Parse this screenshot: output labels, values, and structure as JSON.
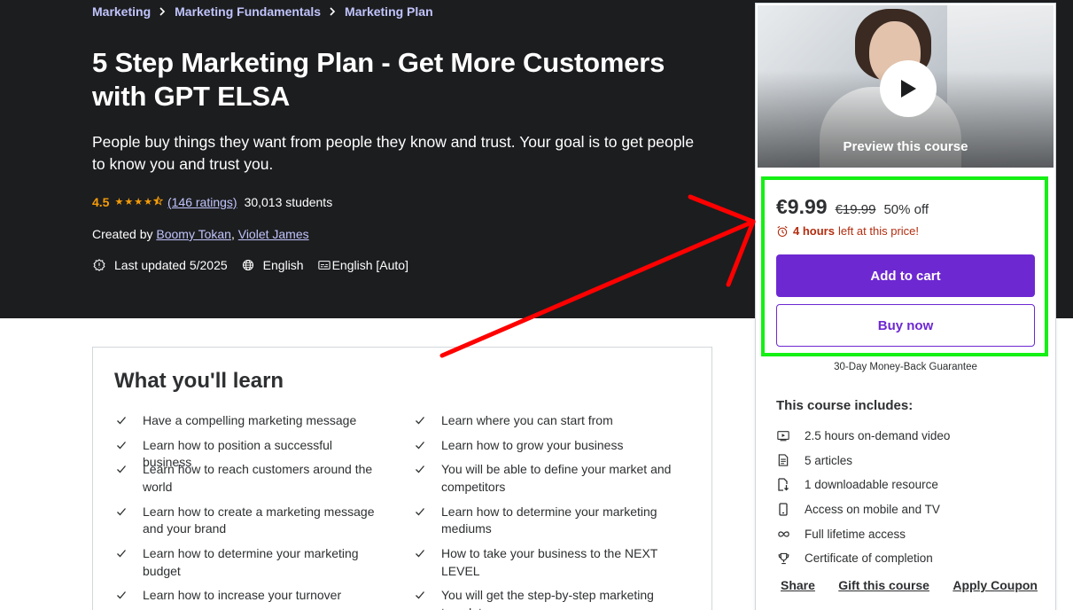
{
  "breadcrumb": [
    {
      "label": "Marketing"
    },
    {
      "label": "Marketing Fundamentals"
    },
    {
      "label": "Marketing Plan"
    }
  ],
  "course": {
    "title": "5 Step Marketing Plan - Get More Customers with GPT ELSA",
    "subtitle": "People buy things they want from people they know and trust. Your goal is to get people to know you and trust you.",
    "rating": "4.5",
    "rating_value": 4.5,
    "rating_max": 5,
    "ratings_count": "(146 ratings)",
    "students": "30,013 students",
    "created_by_label": "Created by",
    "instructors": [
      "Boomy Tokan",
      "Violet James"
    ],
    "instructor_separator": ",",
    "last_updated": "Last updated 5/2025",
    "language": "English",
    "captions": "English [Auto]"
  },
  "learn": {
    "title": "What you'll learn",
    "left": [
      "Have a compelling marketing message",
      "Learn how to position a successful business",
      "Learn how to reach customers around the world",
      "Learn how to create a marketing message and your brand",
      "Learn how to determine your marketing budget",
      "Learn how to increase your turnover"
    ],
    "right": [
      "Learn where you can start from",
      "Learn how to grow your business",
      "You will be able to define your market and competitors",
      "Learn how to determine your marketing mediums",
      "How to take your business to the NEXT LEVEL",
      "You will get the step-by-step marketing template"
    ]
  },
  "sidebar": {
    "preview_label": "Preview this course",
    "price": "€9.99",
    "original_price": "€19.99",
    "discount": "50% off",
    "timer_hours": "4 hours",
    "timer_suffix": "left at this price!",
    "add_to_cart": "Add to cart",
    "buy_now": "Buy now",
    "guarantee": "30-Day Money-Back Guarantee",
    "includes_title": "This course includes:",
    "includes": [
      {
        "icon": "video-icon",
        "label": "2.5 hours on-demand video"
      },
      {
        "icon": "article-icon",
        "label": "5 articles"
      },
      {
        "icon": "download-file-icon",
        "label": "1 downloadable resource"
      },
      {
        "icon": "mobile-icon",
        "label": "Access on mobile and TV"
      },
      {
        "icon": "infinity-icon",
        "label": "Full lifetime access"
      },
      {
        "icon": "trophy-icon",
        "label": "Certificate of completion"
      }
    ],
    "links": {
      "share": "Share",
      "gift": "Gift this course",
      "coupon": "Apply Coupon"
    }
  },
  "colors": {
    "hero_bg": "#1c1d1f",
    "link_purple": "#c0c4fc",
    "star_orange": "#f69c08",
    "accent_purple": "#6d28d2",
    "timer_red": "#b32d0f",
    "annotation_green": "#14f014",
    "annotation_red": "#ff0000"
  }
}
